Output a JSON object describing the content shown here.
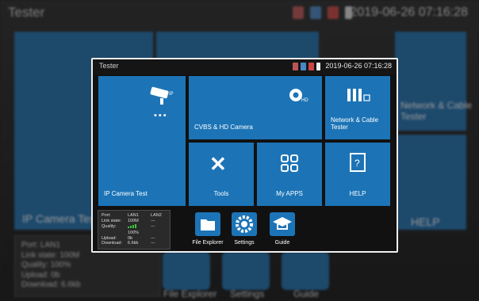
{
  "background": {
    "title": "Tester",
    "datetime": "2019-06-26 07:16:28",
    "tiles": {
      "ip_camera": "IP Camera Test",
      "network_cable": "Network & Cable Tester",
      "help": "HELP"
    },
    "ports": {
      "port_label": "Port:",
      "port_value": "LAN1",
      "link_label": "Link state:",
      "link_value": "100M",
      "quality_label": "Quality:",
      "quality_value": "100%",
      "upload_label": "Upload:",
      "upload_value": "0b",
      "download_label": "Download:",
      "download_value": "6.6kb"
    },
    "bottom": {
      "file_explorer": "File Explorer",
      "settings": "Settings",
      "guide": "Guide"
    }
  },
  "dialog": {
    "title": "Tester",
    "datetime": "2019-06-26 07:16:28",
    "tiles": {
      "ip_camera": "IP Camera Test",
      "cvbs": "CVBS & HD Camera",
      "network": "Network & Cable\nTester",
      "tools": "Tools",
      "myapps": "My APPS",
      "help": "HELP"
    },
    "ports": {
      "port_label": "Port:",
      "col1": "LAN1",
      "col2": "LAN2",
      "link_label": "Link state:",
      "link_value": "100M",
      "link_value2": "---",
      "quality_label": "Quality:",
      "quality_value": "100%",
      "quality_value2": "---",
      "upload_label": "Upload:",
      "upload_value": "0b",
      "upload_value2": "---",
      "download_label": "Download:",
      "download_value": "6.6kb",
      "download_value2": "---"
    },
    "bottom": {
      "file_explorer": "File Explorer",
      "settings": "Settings",
      "guide": "Guide"
    },
    "icons": {
      "ip_camera": "ip-camera-icon",
      "cvbs": "hd-camera-icon",
      "network": "network-connectors-icon",
      "tools": "tools-icon",
      "myapps": "apps-icon",
      "help": "help-book-icon",
      "file_explorer": "folder-icon",
      "settings": "gear-icon",
      "guide": "graduation-cap-icon"
    },
    "colors": {
      "tile": "#1c74b6",
      "signal": "#3ec23e"
    }
  }
}
